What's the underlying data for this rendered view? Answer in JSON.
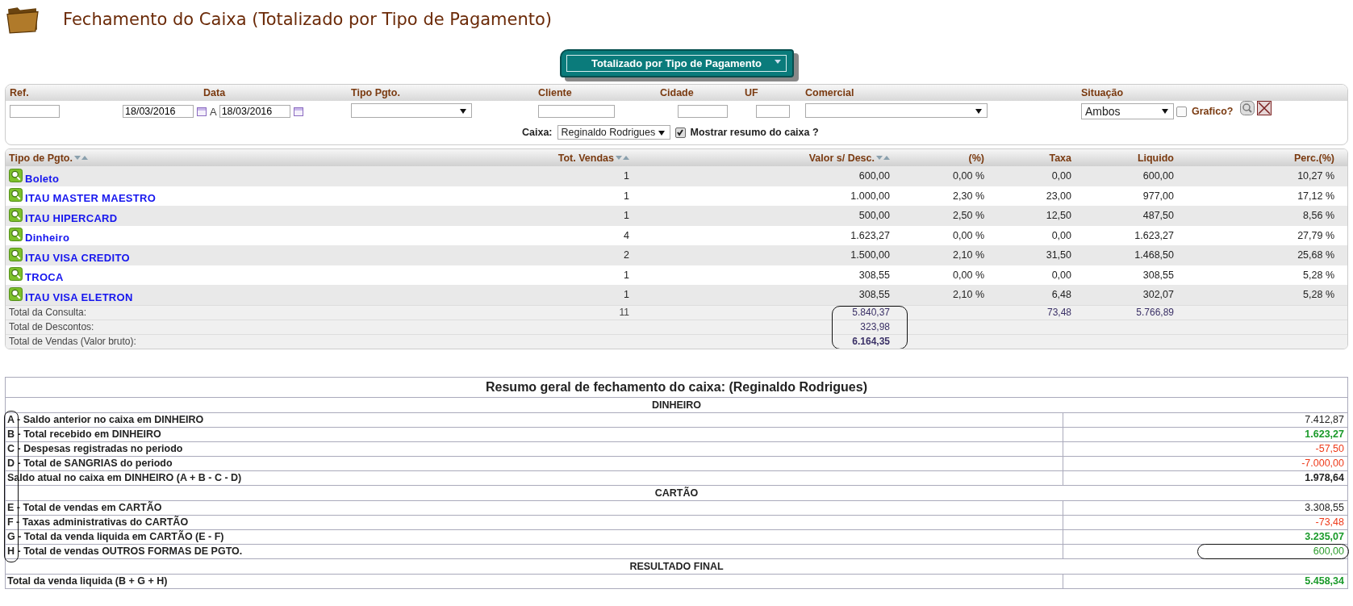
{
  "page": {
    "title": "Fechamento do Caixa (Totalizado por Tipo de Pagamento)"
  },
  "view_button": {
    "label": "Totalizado por Tipo de Pagamento"
  },
  "filters": {
    "ref_label": "Ref.",
    "date_label": "Data",
    "date_from": "18/03/2016",
    "date_separator": "A",
    "date_to": "18/03/2016",
    "payment_type_label": "Tipo Pgto.",
    "client_label": "Cliente",
    "city_label": "Cidade",
    "state_label": "UF",
    "commercial_label": "Comercial",
    "status_label": "Situação",
    "status_value": "Ambos",
    "chart_label": "Grafico?",
    "chart_checked": false,
    "cashier_label": "Caixa:",
    "cashier_value": "Reginaldo Rodrigues",
    "show_summary_label": "Mostrar resumo do caixa ?",
    "show_summary_checked": true
  },
  "table": {
    "columns": [
      {
        "label": "Tipo de Pgto.",
        "sortable": true
      },
      {
        "label": "Tot. Vendas",
        "sortable": true
      },
      {
        "label": "Valor s/ Desc.",
        "sortable": true
      },
      {
        "label": "(%)",
        "sortable": false
      },
      {
        "label": "Taxa",
        "sortable": false
      },
      {
        "label": "Liquido",
        "sortable": false
      },
      {
        "label": "Perc.(%)",
        "sortable": false
      }
    ],
    "rows": [
      {
        "name": "Boleto",
        "sales": "1",
        "value": "600,00",
        "pct": "0,00 %",
        "fee": "0,00",
        "net": "600,00",
        "share": "10,27 %"
      },
      {
        "name": "ITAU MASTER MAESTRO",
        "sales": "1",
        "value": "1.000,00",
        "pct": "2,30 %",
        "fee": "23,00",
        "net": "977,00",
        "share": "17,12 %"
      },
      {
        "name": "ITAU HIPERCARD",
        "sales": "1",
        "value": "500,00",
        "pct": "2,50 %",
        "fee": "12,50",
        "net": "487,50",
        "share": "8,56 %"
      },
      {
        "name": "Dinheiro",
        "sales": "4",
        "value": "1.623,27",
        "pct": "0,00 %",
        "fee": "0,00",
        "net": "1.623,27",
        "share": "27,79 %"
      },
      {
        "name": "ITAU VISA CREDITO",
        "sales": "2",
        "value": "1.500,00",
        "pct": "2,10 %",
        "fee": "31,50",
        "net": "1.468,50",
        "share": "25,68 %"
      },
      {
        "name": "TROCA",
        "sales": "1",
        "value": "308,55",
        "pct": "0,00 %",
        "fee": "0,00",
        "net": "308,55",
        "share": "5,28 %"
      },
      {
        "name": "ITAU VISA ELETRON",
        "sales": "1",
        "value": "308,55",
        "pct": "2,10 %",
        "fee": "6,48",
        "net": "302,07",
        "share": "5,28 %"
      }
    ],
    "totals": [
      {
        "label": "Total da Consulta:",
        "sales": "11",
        "value": "5.840,37",
        "fee": "73,48",
        "net": "5.766,89",
        "bold": false
      },
      {
        "label": "Total de Descontos:",
        "value": "323,98",
        "bold": false
      },
      {
        "label": "Total de Vendas (Valor bruto):",
        "value": "6.164,35",
        "bold": true
      }
    ]
  },
  "summary": {
    "title": "Resumo geral de fechamento do caixa: (Reginaldo Rodrigues)",
    "rows": [
      {
        "kind": "section",
        "label": "DINHEIRO"
      },
      {
        "kind": "line",
        "label": "A - Saldo anterior no caixa em DINHEIRO",
        "value": "7.412,87",
        "color": "#222222",
        "bold": false
      },
      {
        "kind": "line",
        "label": "B - Total recebido em DINHEIRO",
        "value": "1.623,27",
        "color": "#1a9a2a",
        "bold": true
      },
      {
        "kind": "line",
        "label": "C - Despesas registradas no periodo",
        "value": "-57,50",
        "color": "#ee3a1a",
        "bold": false
      },
      {
        "kind": "line",
        "label": "D - Total de SANGRIAS do periodo",
        "value": "-7.000,00",
        "color": "#ee3a1a",
        "bold": false
      },
      {
        "kind": "line",
        "label": "Saldo atual no caixa em DINHEIRO (A + B - C - D)",
        "value": "1.978,64",
        "color": "#222222",
        "bold": true
      },
      {
        "kind": "section",
        "label": "CARTÃO"
      },
      {
        "kind": "line",
        "label": "E - Total de vendas em CARTÃO",
        "value": "3.308,55",
        "color": "#222222",
        "bold": false
      },
      {
        "kind": "line",
        "label": "F - Taxas administrativas do CARTÃO",
        "value": "-73,48",
        "color": "#ee3a1a",
        "bold": false
      },
      {
        "kind": "line",
        "label": "G - Total da venda liquida em CARTÃO (E - F)",
        "value": "3.235,07",
        "color": "#1a9a2a",
        "bold": true
      },
      {
        "kind": "line",
        "label": "H - Total de vendas OUTROS FORMAS DE PGTO.",
        "value": "600,00",
        "color": "#2a9a2a",
        "bold": false
      },
      {
        "kind": "section",
        "label": "RESULTADO FINAL"
      },
      {
        "kind": "line",
        "label": "Total da venda liquida (B + G + H)",
        "value": "5.458,34",
        "color": "#1a9a2a",
        "bold": true
      }
    ]
  }
}
